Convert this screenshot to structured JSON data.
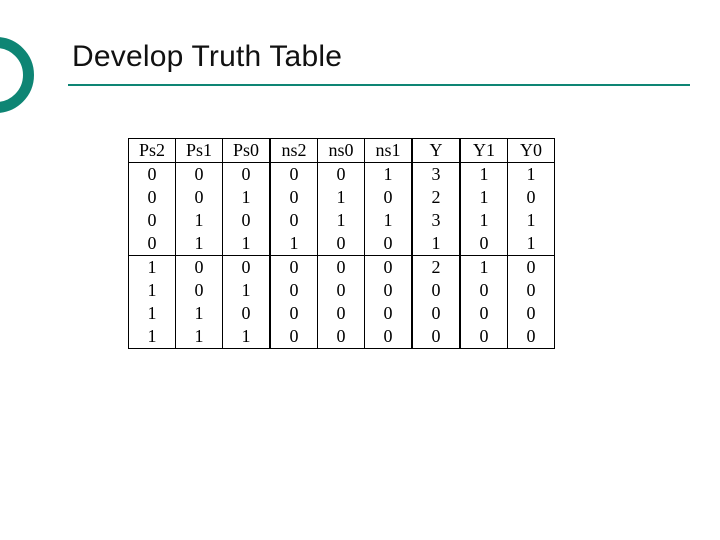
{
  "title": "Develop Truth Table",
  "table": {
    "headers": [
      "Ps2",
      "Ps1",
      "Ps0",
      "ns2",
      "ns0",
      "ns1",
      "Y",
      "Y1",
      "Y0"
    ],
    "rows": [
      [
        "0",
        "0",
        "0",
        "0",
        "0",
        "1",
        "3",
        "1",
        "1"
      ],
      [
        "0",
        "0",
        "1",
        "0",
        "1",
        "0",
        "2",
        "1",
        "0"
      ],
      [
        "0",
        "1",
        "0",
        "0",
        "1",
        "1",
        "3",
        "1",
        "1"
      ],
      [
        "0",
        "1",
        "1",
        "1",
        "0",
        "0",
        "1",
        "0",
        "1"
      ],
      [
        "1",
        "0",
        "0",
        "0",
        "0",
        "0",
        "2",
        "1",
        "0"
      ],
      [
        "1",
        "0",
        "1",
        "0",
        "0",
        "0",
        "0",
        "0",
        "0"
      ],
      [
        "1",
        "1",
        "0",
        "0",
        "0",
        "0",
        "0",
        "0",
        "0"
      ],
      [
        "1",
        "1",
        "1",
        "0",
        "0",
        "0",
        "0",
        "0",
        "0"
      ]
    ]
  }
}
